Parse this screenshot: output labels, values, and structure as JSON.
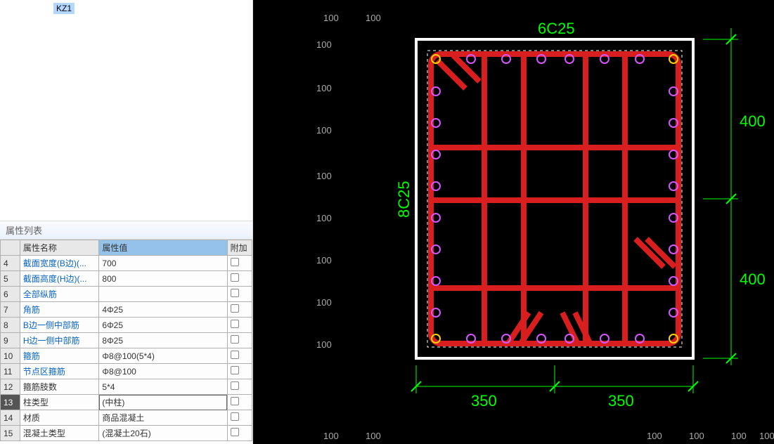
{
  "tree": {
    "selected": "KZ1"
  },
  "prop": {
    "title": "属性列表",
    "headers": {
      "name": "属性名称",
      "value": "属性值",
      "extra": "附加"
    },
    "rows": [
      {
        "n": "4",
        "name": "截面宽度(B边)(...",
        "value": "700",
        "link": true
      },
      {
        "n": "5",
        "name": "截面高度(H边)(...",
        "value": "800",
        "link": true
      },
      {
        "n": "6",
        "name": "全部纵筋",
        "value": "",
        "link": true
      },
      {
        "n": "7",
        "name": "角筋",
        "value": "4Φ25",
        "link": true
      },
      {
        "n": "8",
        "name": "B边一侧中部筋",
        "value": "6Φ25",
        "link": true
      },
      {
        "n": "9",
        "name": "H边一侧中部筋",
        "value": "8Φ25",
        "link": true
      },
      {
        "n": "10",
        "name": "箍筋",
        "value": "Φ8@100(5*4)",
        "link": true
      },
      {
        "n": "11",
        "name": "节点区箍筋",
        "value": "Φ8@100",
        "link": true
      },
      {
        "n": "12",
        "name": "箍筋肢数",
        "value": "5*4",
        "link": false
      },
      {
        "n": "13",
        "name": "柱类型",
        "value": "(中柱)",
        "link": false,
        "selected": true
      },
      {
        "n": "14",
        "name": "材质",
        "value": "商品混凝土",
        "link": false
      },
      {
        "n": "15",
        "name": "混凝土类型",
        "value": "(混凝土20石)",
        "link": false
      }
    ]
  },
  "section": {
    "b_label": "6C25",
    "h_label": "8C25",
    "dims_b": [
      "350",
      "350"
    ],
    "dims_h": [
      "400",
      "400"
    ],
    "ticks": [
      "100",
      "100",
      "100",
      "100",
      "100",
      "100",
      "100",
      "100",
      "100",
      "100",
      "100",
      "100",
      "100",
      "100",
      "100",
      "100"
    ]
  }
}
